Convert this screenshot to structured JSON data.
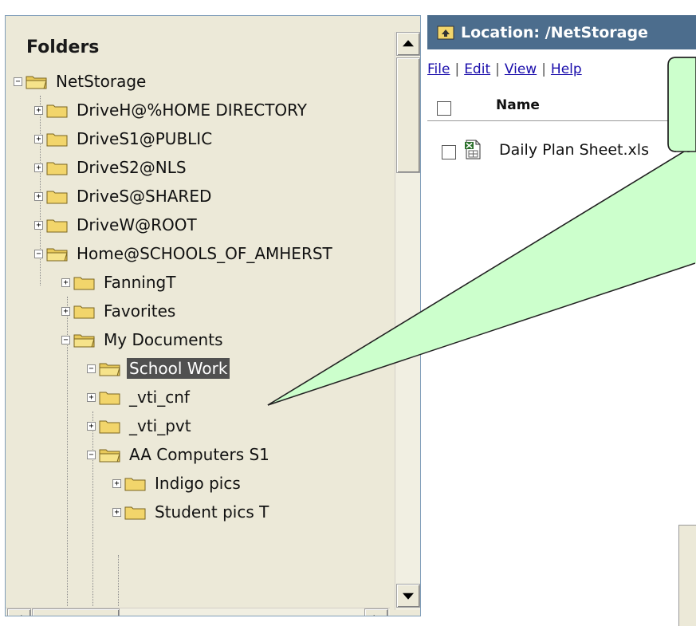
{
  "folders_header": "Folders",
  "tree": [
    {
      "label": "NetStorage",
      "expander": "minus",
      "selected": false
    },
    {
      "label": "DriveH@%HOME DIRECTORY",
      "expander": "plus",
      "selected": false
    },
    {
      "label": "DriveS1@PUBLIC",
      "expander": "plus",
      "selected": false
    },
    {
      "label": "DriveS2@NLS",
      "expander": "plus",
      "selected": false
    },
    {
      "label": "DriveS@SHARED",
      "expander": "plus",
      "selected": false
    },
    {
      "label": "DriveW@ROOT",
      "expander": "plus",
      "selected": false
    },
    {
      "label": "Home@SCHOOLS_OF_AMHERST",
      "expander": "minus",
      "selected": false
    },
    {
      "label": "FanningT",
      "expander": "plus",
      "selected": false
    },
    {
      "label": "Favorites",
      "expander": "plus",
      "selected": false
    },
    {
      "label": "My Documents",
      "expander": "minus",
      "selected": false
    },
    {
      "label": "School Work",
      "expander": "minus",
      "selected": true
    },
    {
      "label": "_vti_cnf",
      "expander": "plus",
      "selected": false
    },
    {
      "label": "_vti_pvt",
      "expander": "plus",
      "selected": false
    },
    {
      "label": "AA Computers S1",
      "expander": "minus",
      "selected": false
    },
    {
      "label": "Indigo pics",
      "expander": "plus",
      "selected": false
    },
    {
      "label": "Student pics T",
      "expander": "plus",
      "selected": false
    }
  ],
  "location": {
    "text": "Location: /NetStorage"
  },
  "menu": {
    "file": "File",
    "edit": "Edit",
    "view": "View",
    "help": "Help",
    "separator": "|"
  },
  "list": {
    "name_header": "Name",
    "files": [
      {
        "name": "Daily Plan Sheet.xls",
        "icon": "excel-file-icon"
      }
    ]
  },
  "colors": {
    "location_bar": "#4c6d8d",
    "callout_fill": "#ccffcc",
    "selection": "#505050",
    "pane_background": "#ece9d8"
  }
}
